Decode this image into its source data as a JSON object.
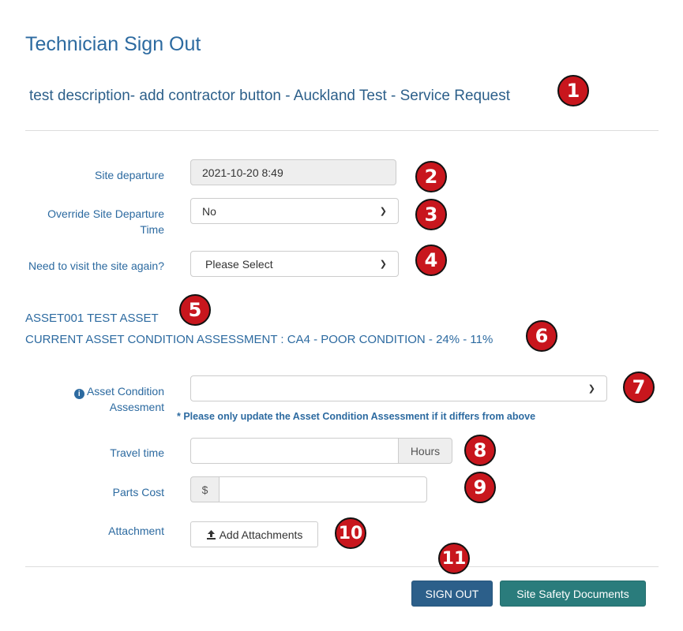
{
  "header": {
    "title": "Technician Sign Out",
    "subtitle": "test description- add contractor button - Auckland Test - Service Request"
  },
  "form": {
    "site_departure": {
      "label": "Site departure",
      "value": "2021-10-20 8:49"
    },
    "override_departure": {
      "label_line1": "Override Site Departure",
      "label_line2": "Time",
      "selected": "No"
    },
    "visit_again": {
      "label": "Need to visit the site again?",
      "selected": "Please Select"
    },
    "asset": {
      "name": "ASSET001 TEST ASSET",
      "current_assessment": "CURRENT ASSET CONDITION ASSESSMENT : CA4 - POOR CONDITION - 24% - 11%"
    },
    "asset_condition": {
      "label_line1": "Asset Condition",
      "label_line2": "Assesment",
      "selected": "",
      "note": "* Please only update the Asset Condition Assessment if it differs from above"
    },
    "travel_time": {
      "label": "Travel time",
      "value": "",
      "addon": "Hours"
    },
    "parts_cost": {
      "label": "Parts Cost",
      "addon": "$",
      "value": ""
    },
    "attachment": {
      "label": "Attachment",
      "button": "Add Attachments"
    }
  },
  "actions": {
    "sign_out": "SIGN OUT",
    "safety_docs": "Site Safety Documents"
  },
  "markers": [
    "1",
    "2",
    "3",
    "4",
    "5",
    "6",
    "7",
    "8",
    "9",
    "10",
    "11"
  ],
  "colors": {
    "marker": "#c8161d",
    "primary": "#2c5f8a",
    "teal": "#2a7c7c",
    "text": "#2c6aa0"
  }
}
